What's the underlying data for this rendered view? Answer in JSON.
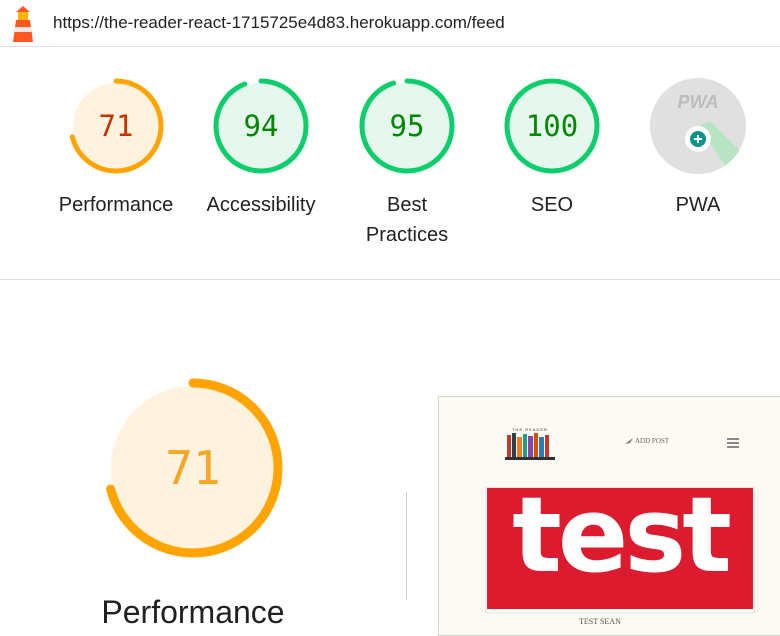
{
  "browser": {
    "url": "https://the-reader-react-1715725e4d83.herokuapp.com/feed"
  },
  "colors": {
    "average": "#ffa400",
    "average_text": "#c33300",
    "average_bg": "#fff3e0",
    "pass": "#0cce6b",
    "pass_text": "#008800",
    "pass_bg": "#e6f7ee",
    "pwa_bg": "#e0e0e0"
  },
  "gauges": [
    {
      "label": "Performance",
      "score": "71",
      "fraction": 0.71,
      "status": "average"
    },
    {
      "label": "Accessibility",
      "score": "94",
      "fraction": 0.94,
      "status": "pass"
    },
    {
      "label": "Best Practices",
      "score": "95",
      "fraction": 0.95,
      "status": "pass"
    },
    {
      "label": "SEO",
      "score": "100",
      "fraction": 1.0,
      "status": "pass"
    },
    {
      "label": "PWA",
      "badge_text": "PWA",
      "icon": "pwa-plus-icon"
    }
  ],
  "main": {
    "score": "71",
    "fraction": 0.71,
    "label": "Performance"
  },
  "screenshot": {
    "logo_text": "THE READER",
    "add_post": "ADD POST",
    "banner_text": "test",
    "caption": "TEST SEAN"
  }
}
